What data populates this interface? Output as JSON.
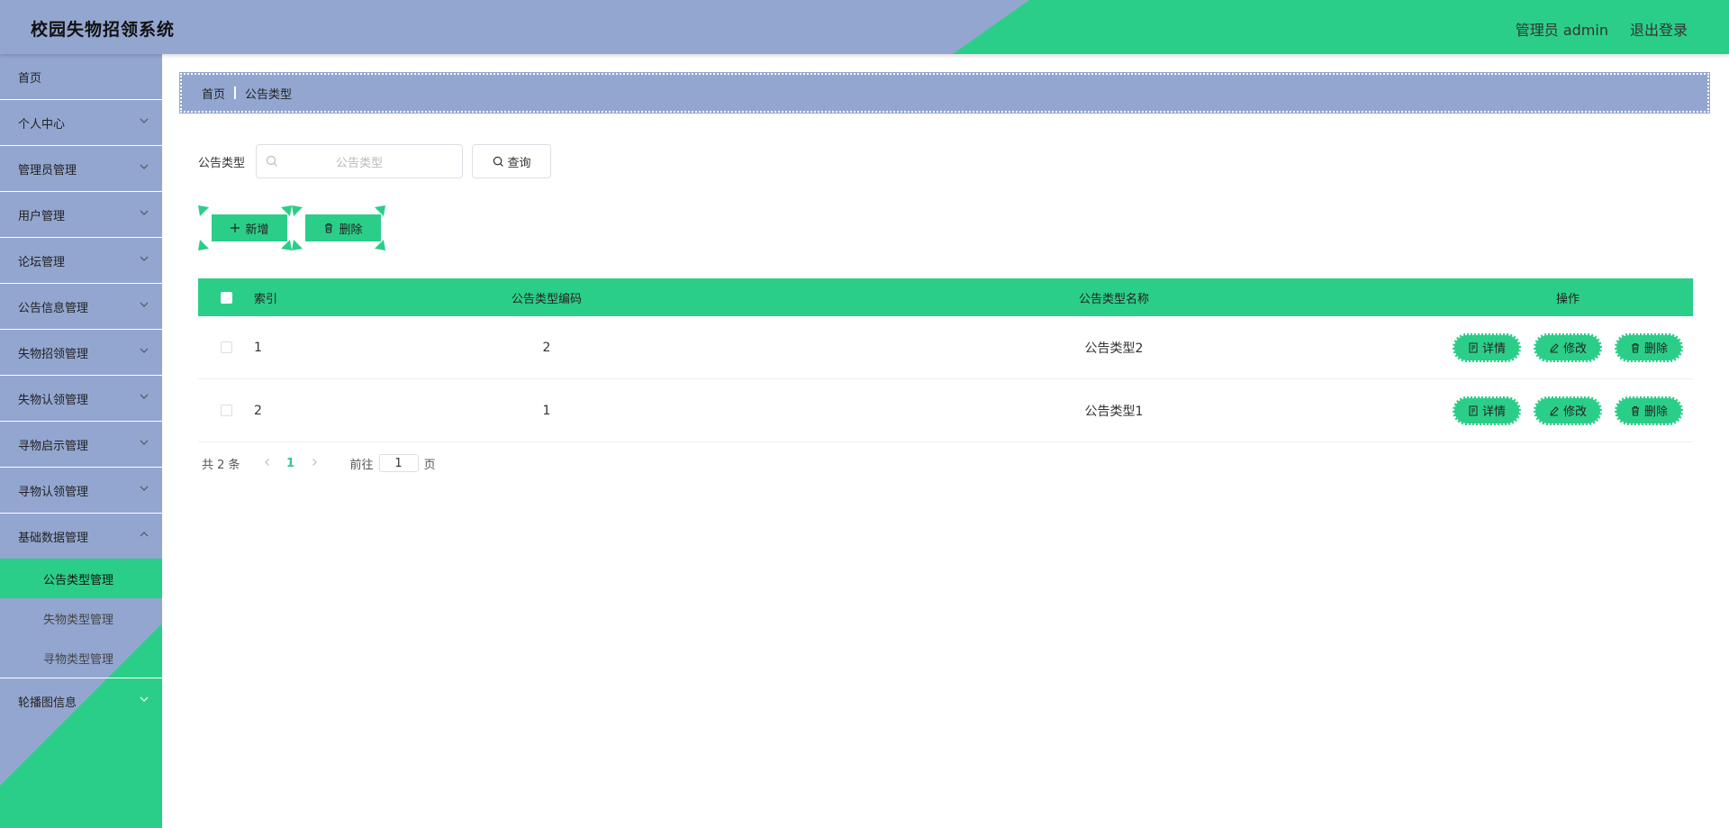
{
  "header": {
    "title": "校园失物招领系统",
    "user_label": "管理员 admin",
    "logout_label": "退出登录"
  },
  "colors": {
    "accent": "#2bce88",
    "primary": "#93a6d0"
  },
  "sidebar": {
    "items": [
      {
        "label": "首页"
      },
      {
        "label": "个人中心"
      },
      {
        "label": "管理员管理"
      },
      {
        "label": "用户管理"
      },
      {
        "label": "论坛管理"
      },
      {
        "label": "公告信息管理"
      },
      {
        "label": "失物招领管理"
      },
      {
        "label": "失物认领管理"
      },
      {
        "label": "寻物启示管理"
      },
      {
        "label": "寻物认领管理"
      },
      {
        "label": "基础数据管理"
      }
    ],
    "submenu": [
      {
        "label": "公告类型管理"
      },
      {
        "label": "失物类型管理"
      },
      {
        "label": "寻物类型管理"
      }
    ],
    "last_item": {
      "label": "轮播图信息"
    }
  },
  "breadcrumb": {
    "home": "首页",
    "current": "公告类型"
  },
  "search": {
    "label": "公告类型",
    "placeholder": "公告类型",
    "query_button": "查询"
  },
  "actions": {
    "add_label": "新增",
    "delete_label": "删除"
  },
  "table": {
    "headers": {
      "index": "索引",
      "code": "公告类型编码",
      "name": "公告类型名称",
      "ops": "操作"
    },
    "rows": [
      {
        "index": "1",
        "code": "2",
        "name": "公告类型2"
      },
      {
        "index": "2",
        "code": "1",
        "name": "公告类型1"
      }
    ],
    "op_labels": {
      "detail": "详情",
      "edit": "修改",
      "delete": "删除"
    }
  },
  "pagination": {
    "total": "共 2 条",
    "current_page": "1",
    "goto_label": "前往",
    "goto_value": "1",
    "page_suffix": "页"
  }
}
